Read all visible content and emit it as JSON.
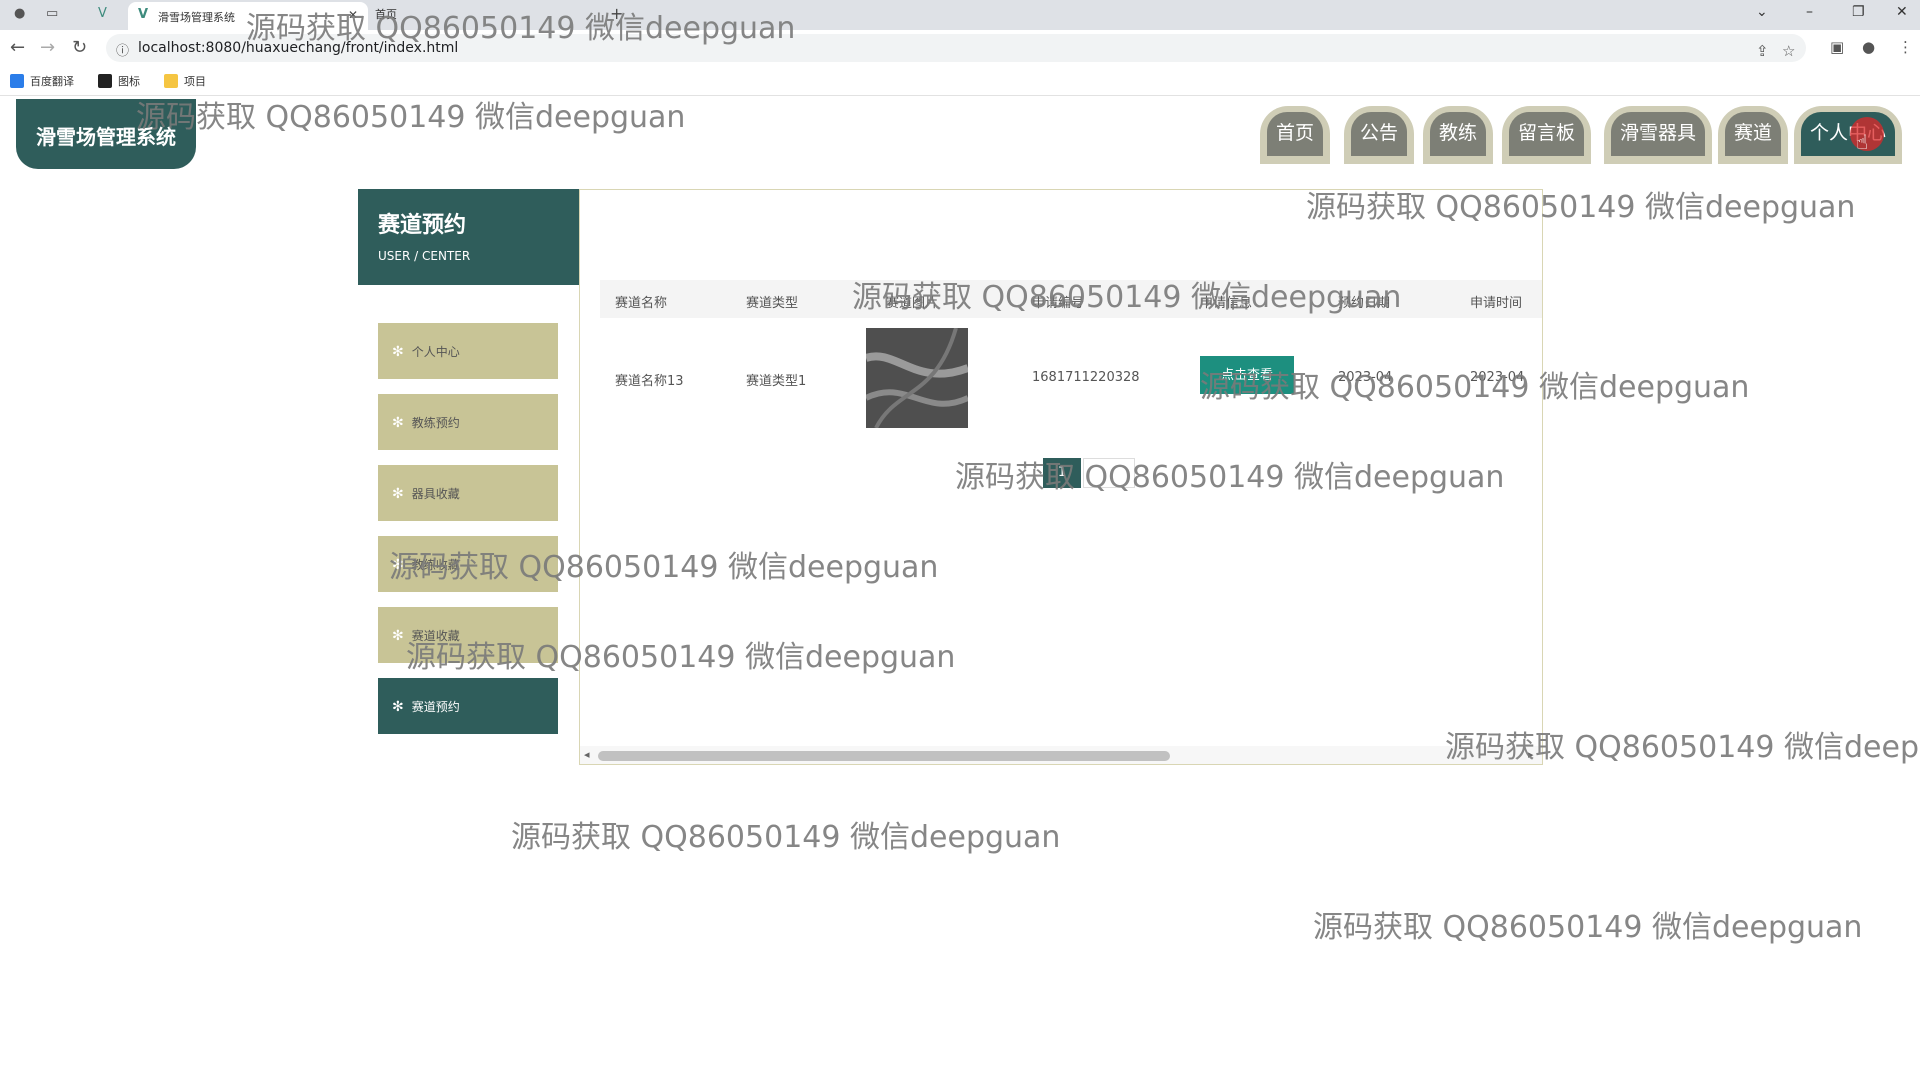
{
  "browser": {
    "tab_title": "滑雪场管理系统",
    "tab2_title": "首页",
    "url": "localhost:8080/huaxuechang/front/index.html",
    "bookmarks": [
      "百度翻译",
      "图标",
      "项目"
    ]
  },
  "site": {
    "logo": "滑雪场管理系统",
    "nav": [
      "首页",
      "公告",
      "教练",
      "留言板",
      "滑雪器具",
      "赛道",
      "个人中心"
    ],
    "active_nav": "个人中心"
  },
  "section": {
    "title": "赛道预约",
    "subtitle": "USER / CENTER"
  },
  "sidebar": {
    "items": [
      "个人中心",
      "教练预约",
      "器具收藏",
      "教练收藏",
      "赛道收藏",
      "赛道预约"
    ],
    "active": "赛道预约"
  },
  "table": {
    "headers": [
      "赛道名称",
      "赛道类型",
      "赛道图片",
      "申请编号",
      "申请信息",
      "预约日期",
      "申请时间"
    ],
    "rows": [
      {
        "name": "赛道名称13",
        "type": "赛道类型1",
        "image_icon": "race-track-image",
        "number": "1681711220328",
        "action": "点击查看",
        "date": "2023-04",
        "time": "2023-04"
      }
    ]
  },
  "pagination": {
    "current": "1"
  },
  "watermark": "源码获取 QQ86050149 微信deepguan",
  "colors": {
    "primary": "#2f5d5b",
    "sidebar": "#c8c496",
    "nav_gray": "#7d7f76",
    "button": "#1d8f7f"
  }
}
